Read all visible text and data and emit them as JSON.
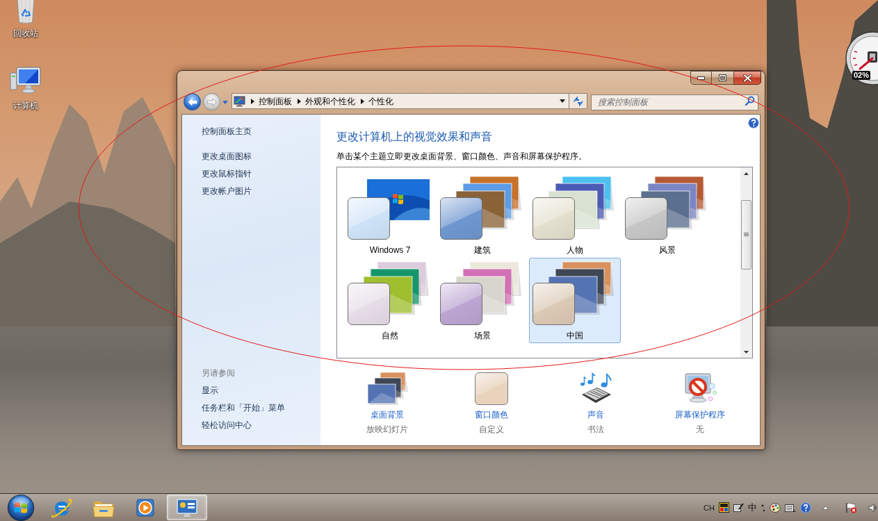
{
  "desktop": {
    "icons": [
      {
        "kind": "recycle-bin",
        "label": "回收站"
      },
      {
        "kind": "computer",
        "label": "计算机"
      }
    ],
    "gadget": {
      "reading": "02%"
    }
  },
  "window": {
    "caption_buttons": [
      {
        "kind": "minimize"
      },
      {
        "kind": "maximize"
      },
      {
        "kind": "close"
      }
    ]
  },
  "address_bar": {
    "crumbs": [
      "控制面板",
      "外观和个性化",
      "个性化"
    ]
  },
  "search": {
    "placeholder": "搜索控制面板"
  },
  "sidebar": {
    "home": "控制面板主页",
    "links": [
      "更改桌面图标",
      "更改鼠标指针",
      "更改帐户图片"
    ],
    "see_also": {
      "title": "另请参阅",
      "links": [
        "显示",
        "任务栏和「开始」菜单",
        "轻松访问中心"
      ]
    }
  },
  "main": {
    "title": "更改计算机上的视觉效果和声音",
    "description": "单击某个主题立即更改桌面背景、窗口颜色、声音和屏幕保护程序。",
    "themes": [
      {
        "label": "Windows 7",
        "kind": "single",
        "color": "#cfe3f8",
        "selected": false
      },
      {
        "label": "建筑",
        "kind": "stack",
        "color": "#6f97d0",
        "selected": false
      },
      {
        "label": "人物",
        "kind": "stack",
        "color": "#e4e0cf",
        "selected": false
      },
      {
        "label": "风景",
        "kind": "stack",
        "color": "#c6c6c6",
        "selected": false
      },
      {
        "label": "自然",
        "kind": "stack",
        "color": "#e6dde8",
        "selected": false
      },
      {
        "label": "场景",
        "kind": "stack",
        "color": "#bca5d2",
        "selected": false
      },
      {
        "label": "中国",
        "kind": "stack",
        "color": "#dccab6",
        "selected": true
      }
    ]
  },
  "settings": [
    {
      "kind": "background",
      "label": "桌面背景",
      "value": "放映幻灯片"
    },
    {
      "kind": "color",
      "label": "窗口颜色",
      "value": "自定义"
    },
    {
      "kind": "sound",
      "label": "声音",
      "value": "书法"
    },
    {
      "kind": "screensaver",
      "label": "屏幕保护程序",
      "value": "无"
    }
  ],
  "taskbar": {
    "apps": [
      {
        "kind": "browser",
        "selected": false
      },
      {
        "kind": "folder",
        "selected": false
      },
      {
        "kind": "media",
        "selected": false
      },
      {
        "kind": "control-panel",
        "selected": true
      }
    ],
    "tray": {
      "language": "CH",
      "input_mode": "中"
    }
  }
}
